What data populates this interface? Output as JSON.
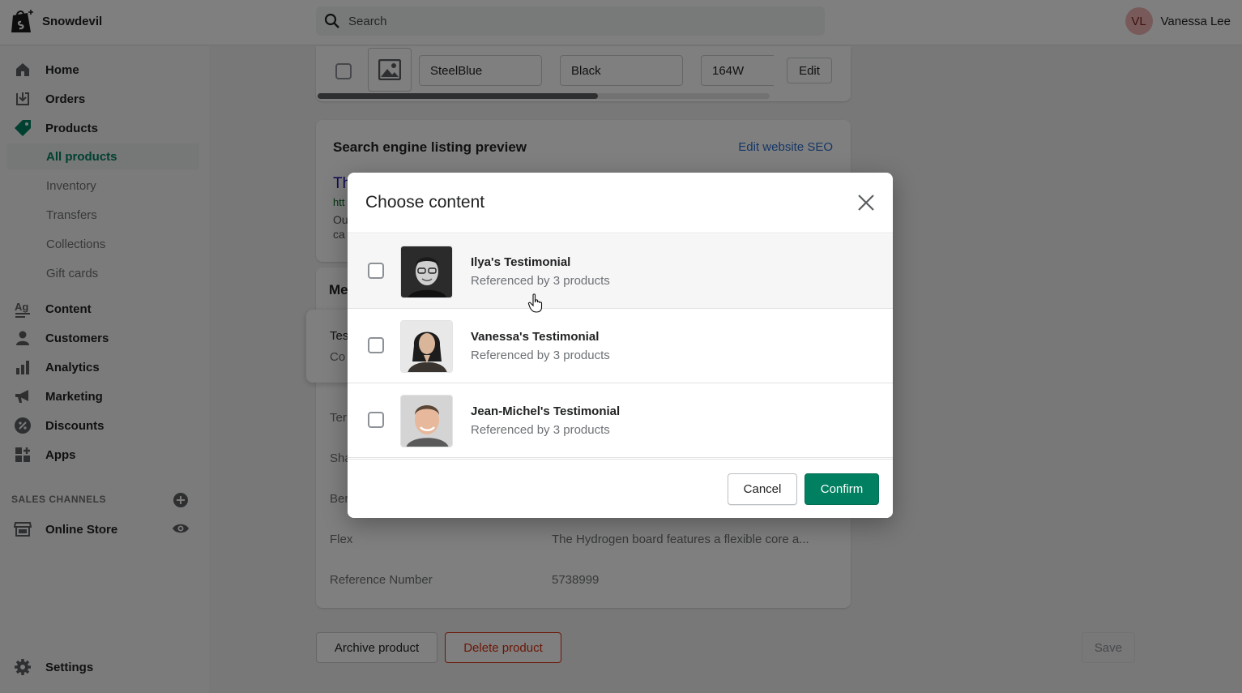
{
  "topbar": {
    "store_name": "Snowdevil",
    "search_placeholder": "Search",
    "user_initials": "VL",
    "user_name": "Vanessa Lee"
  },
  "sidebar": {
    "items": [
      {
        "label": "Home",
        "icon": "home-icon"
      },
      {
        "label": "Orders",
        "icon": "orders-icon"
      },
      {
        "label": "Products",
        "icon": "tag-icon"
      },
      {
        "label": "Content",
        "icon": "content-icon"
      },
      {
        "label": "Customers",
        "icon": "person-icon"
      },
      {
        "label": "Analytics",
        "icon": "bar-chart-icon"
      },
      {
        "label": "Marketing",
        "icon": "megaphone-icon"
      },
      {
        "label": "Discounts",
        "icon": "discount-icon"
      },
      {
        "label": "Apps",
        "icon": "apps-icon"
      }
    ],
    "product_subitems": [
      "All products",
      "Inventory",
      "Transfers",
      "Collections",
      "Gift cards"
    ],
    "sales_channels_label": "SALES CHANNELS",
    "online_store": "Online Store",
    "settings": "Settings"
  },
  "variant_row": {
    "color": "SteelBlue",
    "binding": "Black",
    "size": "164W",
    "edit_label": "Edit",
    "scroll_fraction": 0.62
  },
  "seo": {
    "title": "Search engine listing preview",
    "edit_link": "Edit website SEO",
    "preview_title": "Th",
    "preview_url": "htt",
    "preview_desc_line1": "Ou",
    "preview_desc_line2": "ca"
  },
  "metafields": {
    "heading": "Me",
    "testimonial_label": "Tes",
    "testimonial_value": "Co",
    "rows": [
      {
        "label": "Ter",
        "value": ""
      },
      {
        "label": "Sha",
        "value": ""
      },
      {
        "label": "Ber",
        "value": ""
      },
      {
        "label": "Flex",
        "value": "The Hydrogen board features a flexible core a..."
      },
      {
        "label": "Reference Number",
        "value": "5738999"
      }
    ]
  },
  "footer_actions": {
    "archive": "Archive product",
    "delete": "Delete product",
    "save": "Save"
  },
  "modal": {
    "title": "Choose content",
    "items": [
      {
        "title": "Ilya's Testimonial",
        "subtitle": "Referenced by 3 products"
      },
      {
        "title": "Vanessa's Testimonial",
        "subtitle": "Referenced by 3 products"
      },
      {
        "title": "Jean-Michel's Testimonial",
        "subtitle": "Referenced by 3 products"
      }
    ],
    "cancel": "Cancel",
    "confirm": "Confirm"
  },
  "colors": {
    "primary_green": "#008060",
    "link_blue": "#2c6ecb",
    "critical_red": "#d82c0d"
  }
}
